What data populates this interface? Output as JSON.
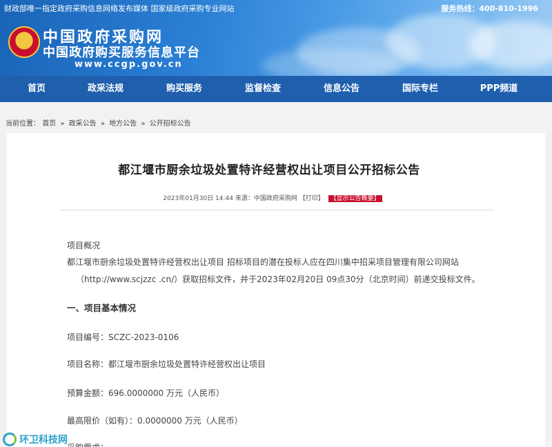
{
  "topbar": {
    "left": "财政部唯一指定政府采购信息网络发布媒体 国家级政府采购专业网站",
    "hotline": "服务热线：400-810-1996"
  },
  "site": {
    "name": "中国政府采购网",
    "subtitle": "中国政府购买服务信息平台",
    "url": "www.ccgp.gov.cn"
  },
  "nav": {
    "items": [
      "首页",
      "政采法规",
      "购买服务",
      "监督检查",
      "信息公告",
      "国际专栏",
      "PPP频道"
    ]
  },
  "breadcrumb": {
    "prefix": "当前位置：",
    "items": [
      "首页",
      "政采公告",
      "地方公告",
      "公开招标公告"
    ],
    "sep": "»"
  },
  "article": {
    "title": "都江堰市厨余垃圾处置特许经营权出让项目公开招标公告",
    "meta_date": "2023年01月30日 14:44",
    "meta_source": "来源：中国政府采购网",
    "meta_print": "【打印】",
    "meta_tag": "【显示公告概要】",
    "overview_head": "项目概况",
    "overview_line1": "都江堰市厨余垃圾处置特许经营权出让项目 招标项目的潜在投标人应在四川集中招采项目管理有限公司网站",
    "overview_line2": "（http://www.scjzzc .cn/）获取招标文件，并于2023年02月20日 09点30分（北京时间）前递交投标文件。",
    "section1": "一、项目基本情况",
    "project_no": "项目编号：SCZC-2023-0106",
    "project_name": "项目名称：都江堰市厨余垃圾处置特许经营权出让项目",
    "budget": "预算金额：696.0000000 万元（人民币）",
    "max_price": "最高限价（如有）：0.0000000 万元（人民币）",
    "next_cut": "采购需求："
  },
  "watermark": {
    "text": "环卫科技网"
  }
}
